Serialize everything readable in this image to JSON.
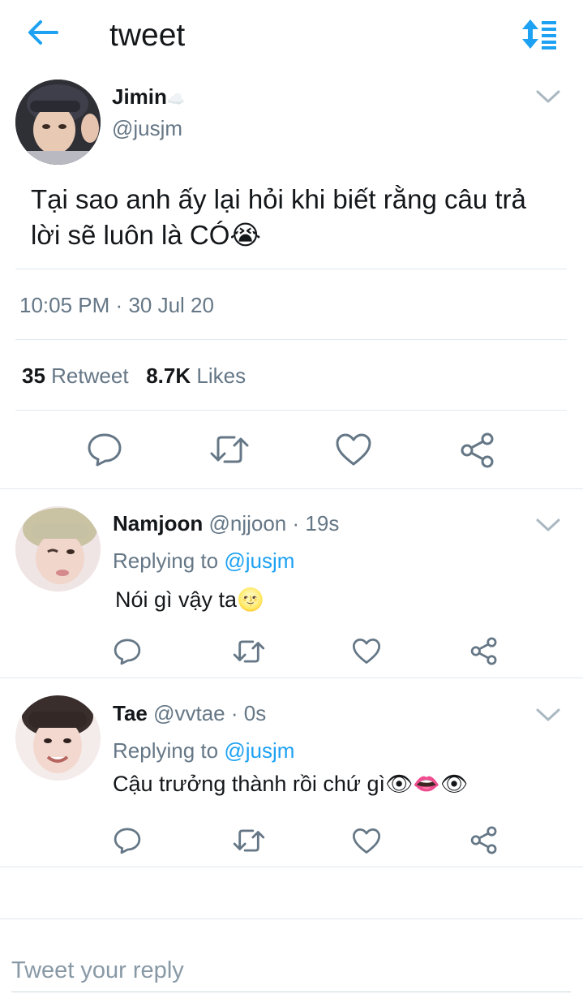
{
  "header": {
    "title": "tweet"
  },
  "main_tweet": {
    "name": "Jimin",
    "name_emoji": "☁️",
    "handle": "@jusjm",
    "text": "Tại sao anh ấy lại hỏi khi biết rằng câu trả lời sẽ luôn là CÓ😭",
    "time": "10:05 PM",
    "separator": "·",
    "date": "30 Jul 20",
    "retweets_count": "35",
    "retweets_label": "Retweet",
    "likes_count": "8.7K",
    "likes_label": "Likes"
  },
  "replies": [
    {
      "name": "Namjoon",
      "handle": "@njjoon",
      "separator": "·",
      "age": "19s",
      "replying_label": "Replying to",
      "replying_handle": "@jusjm",
      "text": "Nói gì vậy ta🌝"
    },
    {
      "name": "Tae",
      "handle": "@vvtae",
      "separator": "·",
      "age": "0s",
      "replying_label": "Replying to",
      "replying_handle": "@jusjm",
      "text": "Cậu trưởng thành rồi chứ gì👁👄👁"
    }
  ],
  "compose": {
    "placeholder": "Tweet your reply"
  },
  "colors": {
    "accent": "#1da1f2",
    "muted": "#657786",
    "divider": "#e1e8ed"
  }
}
